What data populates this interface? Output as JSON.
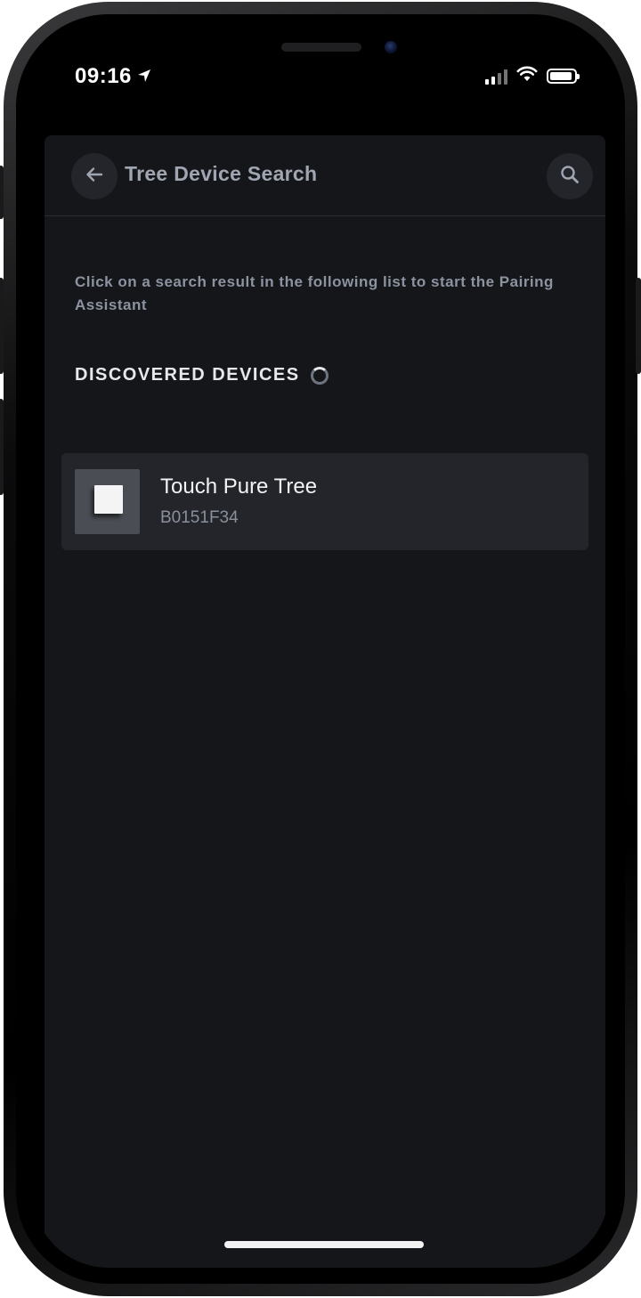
{
  "status_bar": {
    "time": "09:16"
  },
  "header": {
    "title": "Tree Device Search"
  },
  "instructions": "Click on a search result in the following list to start the Pairing Assistant",
  "section": {
    "title": "DISCOVERED DEVICES"
  },
  "devices": [
    {
      "name": "Touch Pure Tree",
      "id": "B0151F34",
      "icon": "switch-thumbnail"
    }
  ],
  "colors": {
    "background": "#151619",
    "card": "#23252a",
    "text_primary": "#f2f3f5",
    "text_secondary": "#8a909b"
  }
}
